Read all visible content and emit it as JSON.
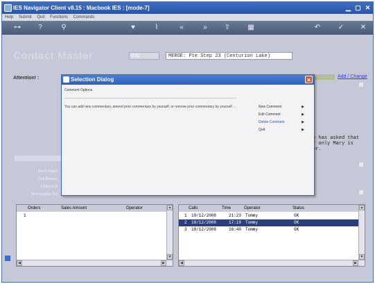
{
  "window": {
    "title": "IES Navigator Client v8.15 : Macbook IES :      [mode-7]"
  },
  "menu": [
    "Help",
    "Submit",
    "Quit",
    "Functions",
    "Commands"
  ],
  "toolbar": {
    "icons": [
      "key-icon",
      "help-icon",
      "search-icon",
      "heart-icon",
      "clip-icon",
      "rewind-icon",
      "fast-forward-icon",
      "upload-icon",
      "grid-icon",
      "back-icon",
      "check-icon",
      "close-icon"
    ]
  },
  "form": {
    "heading": "Contact Master",
    "code": "0082",
    "description": "MEROE: Pte Step 23 (Centurion Lake)",
    "attention_label": "Attention! :",
    "add_change": "Add / Change",
    "bg_text_lines": [
      "e has asked that",
      "f only Mary is",
      "er."
    ],
    "left_labels": [
      "Bnom Orgen",
      "Cntl Reason",
      "Ttl Account",
      "Merchandise Ref"
    ]
  },
  "orders_panel": {
    "headers": {
      "orders": "Orders",
      "sales": "Sales Amount",
      "operator": "Operator"
    },
    "rows": [
      {
        "num": "1"
      }
    ]
  },
  "calls_panel": {
    "headers": {
      "calls": "Calls",
      "time": "Time",
      "operator": "Operator",
      "status": "Status"
    },
    "rows": [
      {
        "num": "1",
        "date": "19/12/2008",
        "time": "21:23",
        "operator": "Tommy",
        "status": "OK"
      },
      {
        "num": "2",
        "date": "18/12/2008",
        "time": "17:19",
        "operator": "Tommy",
        "status": "OK"
      },
      {
        "num": "3",
        "date": "18/12/2008",
        "time": "16:40",
        "operator": "Tommy",
        "status": "OK"
      }
    ]
  },
  "dialog": {
    "title": "Selection Dialog",
    "options_label": "Comment Options",
    "message": "You can add new commentary, amend prior commentary by yourself, or remove prior commentary by yourself ...",
    "items": [
      {
        "label": "New Comment"
      },
      {
        "label": "Edit Comment"
      },
      {
        "label": "Delete Comment"
      },
      {
        "label": "Quit"
      }
    ]
  },
  "colors": {
    "titlebar": "#2f5fbb",
    "content_bg": "#c5c8d6",
    "menu_highlight": "#2b4fc0"
  }
}
